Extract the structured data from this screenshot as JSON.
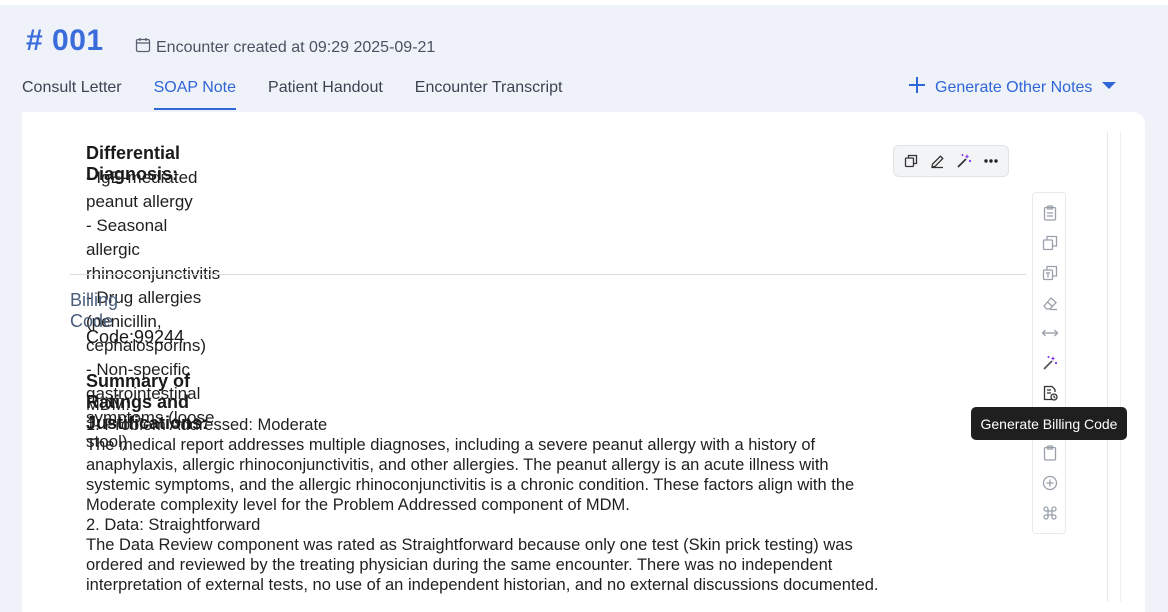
{
  "header": {
    "encounter_id": "# 001",
    "created_text": "Encounter created at 09:29 2025-09-21",
    "generate_other_notes_label": "Generate Other Notes"
  },
  "tabs": [
    {
      "label": "Consult Letter",
      "active": false
    },
    {
      "label": "SOAP Note",
      "active": true
    },
    {
      "label": "Patient Handout",
      "active": false
    },
    {
      "label": "Encounter Transcript",
      "active": false
    }
  ],
  "differential": {
    "heading": "Differential Diagnosis:",
    "items": [
      "- IgE-mediated peanut allergy",
      "- Seasonal allergic rhinoconjunctivitis",
      "- Drug allergies (penicillin, cephalosporins)",
      "- Non-specific gastrointestinal symptoms (loose stool)"
    ]
  },
  "billing": {
    "section_title": "Billing Code",
    "code_line": "Code:99244",
    "summary_heading": "Summary of Ratings and Justifications:",
    "summary_lines": [
      "MDM:",
      "1. Problem Addressed: Moderate",
      "The medical report addresses multiple diagnoses, including a severe peanut allergy with a history of",
      "anaphylaxis, allergic rhinoconjunctivitis, and other allergies. The peanut allergy is an acute illness with",
      "systemic symptoms, and the allergic rhinoconjunctivitis is a chronic condition. These factors align with the",
      "Moderate complexity level for the Problem Addressed component of MDM.",
      "2. Data: Straightforward",
      "The Data Review component was rated as Straightforward because only one test (Skin prick testing) was",
      "ordered and reviewed by the treating physician during the same encounter. There was no independent",
      "interpretation of external tests, no use of an independent historian, and no external discussions documented."
    ]
  },
  "tooltip": {
    "text": "Generate Billing Code"
  },
  "icons": {
    "calendar": "calendar-icon",
    "plus": "plus-icon",
    "caret": "caret-down-icon",
    "hover_toolbar": [
      "copy-icon",
      "edit-pencil-icon",
      "magic-wand-icon",
      "more-dots-icon"
    ],
    "side_toolbar": [
      "clipboard-icon",
      "copy-icon",
      "copy-text-icon",
      "eraser-icon",
      "expand-horizontal-icon",
      "magic-wand-icon",
      "billing-code-icon",
      "clipboard-icon",
      "add-circle-icon",
      "command-icon"
    ]
  },
  "colors": {
    "accent": "#2f66d8",
    "magic": "#7b2ff0",
    "tooltip_bg": "#1f1f1f"
  }
}
